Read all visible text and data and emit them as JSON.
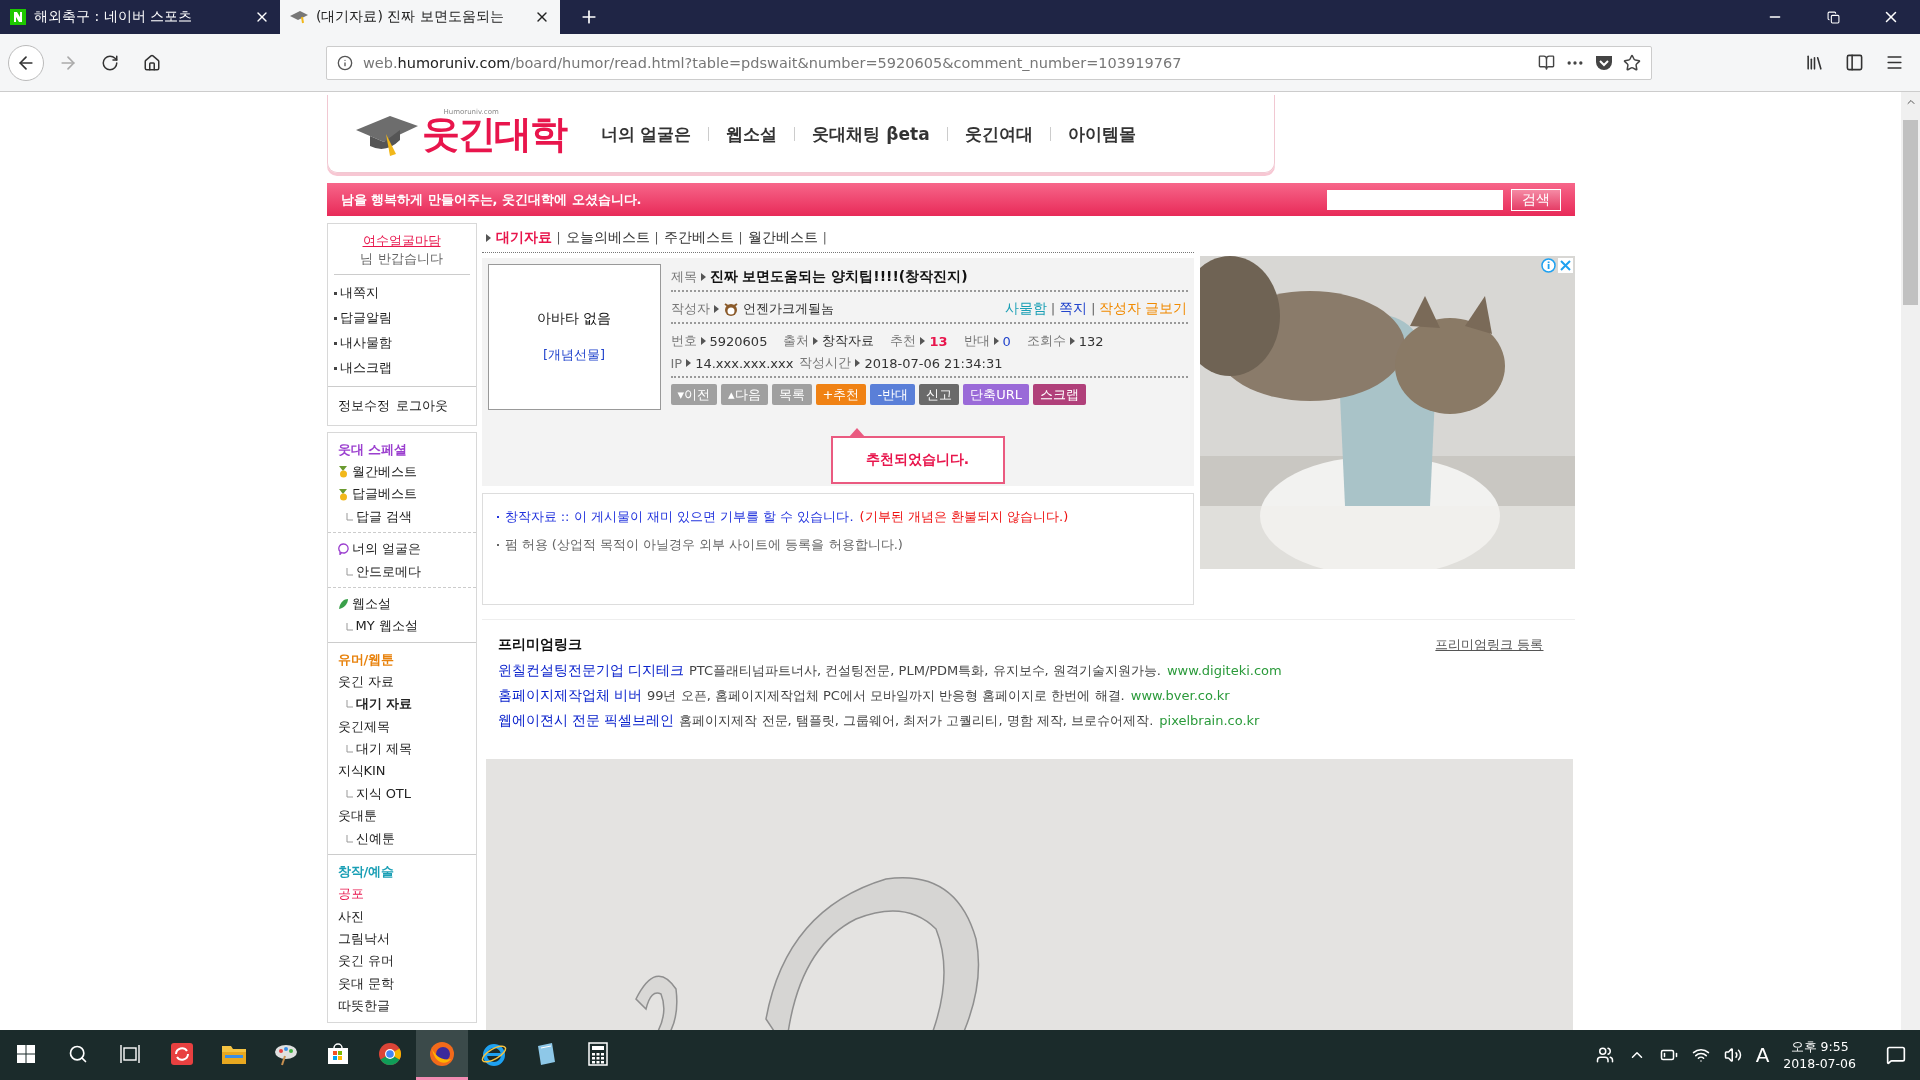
{
  "browser": {
    "tabs": [
      {
        "title": "해외축구 : 네이버 스포츠",
        "kind": "naver",
        "selected": false
      },
      {
        "title": "(대기자료) 진짜 보면도움되는",
        "kind": "site",
        "selected": true
      }
    ],
    "url": {
      "sub": "web.",
      "domain": "humoruniv.com",
      "rest": "/board/humor/read.html?table=pdswait&number=5920605&comment_number=103919767"
    }
  },
  "site": {
    "logo_small": "Humoruniv.com",
    "logo": "웃긴대학",
    "nav": [
      "너의 얼굴은",
      "웹소설",
      "웃대채팅 βeta",
      "웃긴여대",
      "아이템몰"
    ],
    "welcome": "남을 행복하게 만들어주는, 웃긴대학에 오셨습니다.",
    "search_button": "검색"
  },
  "sidebar": {
    "user": "여수얼굴마담",
    "greeting": "님 반갑습니다",
    "menu": [
      "내쪽지",
      "답글알림",
      "내사물함",
      "내스크랩"
    ],
    "actions": [
      "정보수정",
      "로그아웃"
    ],
    "sections": [
      {
        "title": "웃대 스페셜",
        "color": "#9b3fcf",
        "items": [
          {
            "label": "월간베스트",
            "kind": "medal",
            "selected": false,
            "highlighted": false
          },
          {
            "label": "답글베스트",
            "kind": "medal",
            "selected": false,
            "highlighted": false
          },
          {
            "label": "답글 검색",
            "kind": "sub",
            "selected": false,
            "highlighted": false
          }
        ]
      },
      {
        "items": [
          {
            "label": "너의 얼굴은",
            "kind": "bubble",
            "selected": false,
            "highlighted": false
          },
          {
            "label": "안드로메다",
            "kind": "sub",
            "selected": false,
            "highlighted": false
          }
        ]
      },
      {
        "items": [
          {
            "label": "웹소설",
            "kind": "leaf",
            "selected": false,
            "highlighted": false
          },
          {
            "label": "MY 웹소설",
            "kind": "sub",
            "selected": false,
            "highlighted": false
          }
        ]
      },
      {
        "title": "유머/웹툰",
        "color": "#e8820c",
        "items": [
          {
            "label": "웃긴 자료",
            "kind": "main",
            "selected": false,
            "highlighted": false
          },
          {
            "label": "대기 자료",
            "kind": "sub",
            "selected": true,
            "highlighted": false
          },
          {
            "label": "웃긴제목",
            "kind": "main",
            "selected": false,
            "highlighted": false
          },
          {
            "label": "대기 제목",
            "kind": "sub",
            "selected": false,
            "highlighted": false
          },
          {
            "label": "지식KIN",
            "kind": "main",
            "selected": false,
            "highlighted": false
          },
          {
            "label": "지식 OTL",
            "kind": "sub",
            "selected": false,
            "highlighted": false
          },
          {
            "label": "웃대툰",
            "kind": "main",
            "selected": false,
            "highlighted": false
          },
          {
            "label": "신예툰",
            "kind": "sub",
            "selected": false,
            "highlighted": false
          }
        ]
      },
      {
        "title": "창작/예술",
        "color": "#1a9fb5",
        "items": [
          {
            "label": "공포",
            "kind": "main",
            "selected": false,
            "highlighted": true
          },
          {
            "label": "사진",
            "kind": "main",
            "selected": false,
            "highlighted": false
          },
          {
            "label": "그림낙서",
            "kind": "main",
            "selected": false,
            "highlighted": false
          },
          {
            "label": "웃긴 유머",
            "kind": "main",
            "selected": false,
            "highlighted": false
          },
          {
            "label": "웃대 문학",
            "kind": "main",
            "selected": false,
            "highlighted": false
          },
          {
            "label": "따뜻한글",
            "kind": "main",
            "selected": false,
            "highlighted": false
          }
        ]
      }
    ]
  },
  "board_tabs": [
    {
      "label": "대기자료",
      "selected": true,
      "divider": "|"
    },
    {
      "label": "오늘의베스트",
      "selected": false,
      "divider": "|"
    },
    {
      "label": "주간베스트",
      "selected": false,
      "divider": "|"
    },
    {
      "label": "월간베스트",
      "selected": false,
      "divider": "|"
    }
  ],
  "post": {
    "avatar": "아바타 없음",
    "gift": "[개념선물]",
    "title_label": "제목",
    "title": "진짜 보면도움되는 양치팁!!!!(창작진지)",
    "author_label": "작성자",
    "author": "언젠가크게될놈",
    "author_links": [
      {
        "label": "사물함",
        "color": "#1a9fb5"
      },
      {
        "divider": "|",
        "label": "쪽지",
        "color": "#2244cc"
      },
      {
        "divider": "|",
        "label": "작성자 글보기",
        "color": "#f08a00"
      }
    ],
    "meta": [
      {
        "label": "번호",
        "value": "5920605",
        "kind": "plain"
      },
      {
        "label": "출처",
        "value": "창작자료",
        "kind": "plain"
      },
      {
        "label": "추천",
        "value": "13",
        "kind": "up"
      },
      {
        "label": "반대",
        "value": "0",
        "kind": "down"
      },
      {
        "label": "조회수",
        "value": "132",
        "kind": "plain"
      }
    ],
    "ip_label": "IP",
    "ip": "14.xxx.xxx.xxx",
    "time_label": "작성시간",
    "time": "2018-07-06 21:34:31",
    "buttons": [
      {
        "label": "▾이전",
        "color": "#a0a0a0"
      },
      {
        "label": "▴다음",
        "color": "#a0a0a0"
      },
      {
        "label": "목록",
        "color": "#a0a0a0"
      },
      {
        "label": "+추천",
        "color": "#f08214"
      },
      {
        "label": "-반대",
        "color": "#5a7fd8"
      },
      {
        "label": "신고",
        "color": "#6a6a6a"
      },
      {
        "label": "단축URL",
        "color": "#9a6ad8"
      },
      {
        "label": "스크랩",
        "color": "#b0407a"
      }
    ],
    "toast": "추천되었습니다.",
    "notice_main": "창작자료 :: 이 게시물이 재미 있으면 기부를 할 수 있습니다.",
    "notice_warning": "(기부된 개념은 환불되지 않습니다.)",
    "notice_share": "펌 허용 (상업적 목적이 아닐경우 외부 사이트에 등록을 허용합니다.)"
  },
  "premium": {
    "title": "프리미엄링크",
    "register": "프리미엄링크 등록",
    "links": [
      {
        "name": "윈칠컨설팅전문기업 디지테크",
        "desc": "PTC플래티넘파트너사, 컨설팅전문, PLM/PDM특화, 유지보수, 원격기술지원가능.",
        "url": "www.digiteki.com"
      },
      {
        "name": "홈페이지제작업체 비버",
        "desc": "99년 오픈, 홈페이지제작업체 PC에서 모바일까지 반응형 홈페이지로 한번에 해결.",
        "url": "www.bver.co.kr"
      },
      {
        "name": "웹에이젼시 전문 픽셀브레인",
        "desc": "홈페이지제작 전문, 탬플릿, 그룹웨어, 최저가 고퀄리티, 명함 제작, 브로슈어제작.",
        "url": "pixelbrain.co.kr"
      }
    ]
  },
  "taskbar": {
    "apps": [
      {
        "kind": "sync",
        "selected": false
      },
      {
        "kind": "folder",
        "selected": false
      },
      {
        "kind": "paint",
        "selected": false
      },
      {
        "kind": "store",
        "selected": false
      },
      {
        "kind": "chrome",
        "selected": false
      },
      {
        "kind": "firefox",
        "selected": true
      },
      {
        "kind": "ie",
        "selected": false
      },
      {
        "kind": "notes",
        "selected": false
      },
      {
        "kind": "calculator",
        "selected": false
      }
    ],
    "ime": "A",
    "time": "오후 9:55",
    "date": "2018-07-06"
  }
}
